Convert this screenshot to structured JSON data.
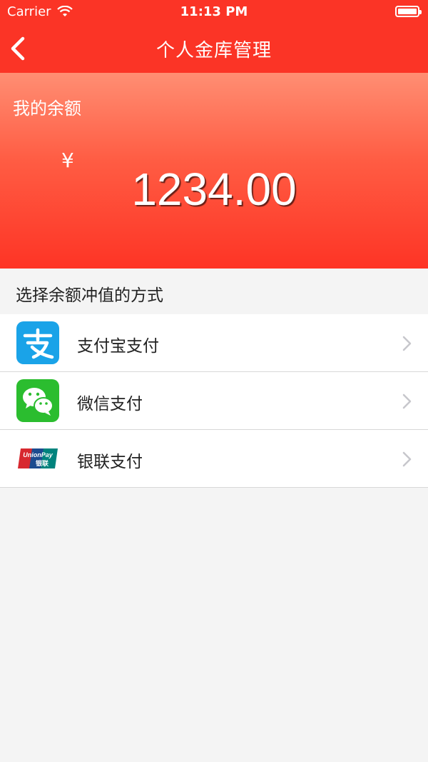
{
  "status_bar": {
    "carrier": "Carrier",
    "time": "11:13 PM",
    "battery_level": 1.0
  },
  "nav": {
    "title": "个人金库管理",
    "back_icon": "chevron-left-icon"
  },
  "balance": {
    "label": "我的余额",
    "currency": "¥",
    "amount": "1234.00"
  },
  "section": {
    "title": "选择余额冲值的方式"
  },
  "payment_methods": [
    {
      "label": "支付宝支付",
      "icon": "alipay-icon",
      "color": "#1aa3e8"
    },
    {
      "label": "微信支付",
      "icon": "wechat-icon",
      "color": "#2bbd2f"
    },
    {
      "label": "银联支付",
      "icon": "unionpay-icon",
      "logo_text": "UnionPay 银联",
      "colors": [
        "#d7282f",
        "#1c4b8f",
        "#00837d"
      ]
    }
  ],
  "colors": {
    "nav_red": "#fb3426",
    "background": "#f4f4f4"
  }
}
